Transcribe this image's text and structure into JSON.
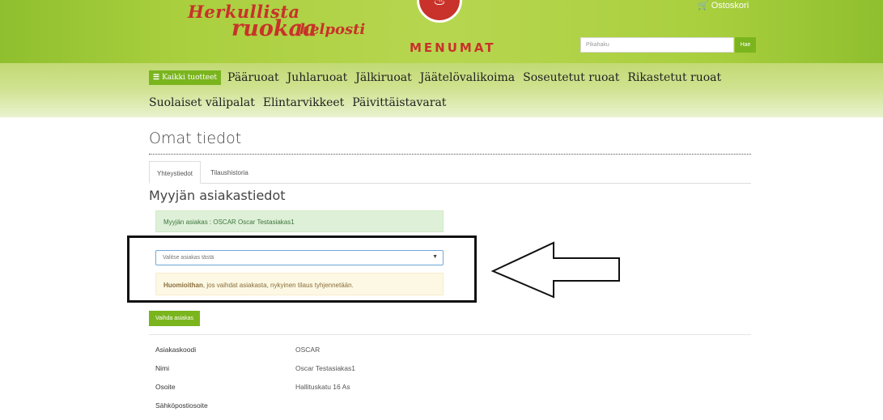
{
  "header": {
    "slogan_line1": "Herkullista",
    "slogan_line2": "ruokaa",
    "slogan_line3": "helposti",
    "brand": "MENUMAT",
    "cart_label": "Ostoskori",
    "search_placeholder": "Pikahaku",
    "search_button": "Hae"
  },
  "nav": {
    "all_products": "Kaikki tuotteet",
    "row1": [
      "Pääruoat",
      "Juhlaruoat",
      "Jälkiruoat",
      "Jäätelövalikoima",
      "Soseutetut ruoat",
      "Rikastetut ruoat"
    ],
    "row2": [
      "Suolaiset välipalat",
      "Elintarvikkeet",
      "Päivittäistavarat"
    ]
  },
  "page": {
    "title": "Omat tiedot",
    "tabs": [
      "Yhteystiedot",
      "Tilaushistoria"
    ],
    "section_title": "Myyjän asiakastiedot",
    "current_customer": "Myyjän asiakas : OSCAR Oscar Testasiakas1",
    "select_placeholder": "Valitse asiakas tästä",
    "warning_bold": "Huomioithan",
    "warning_rest": ", jos vaihdat asiakasta, nykyinen tilaus tyhjennetään.",
    "change_button": "Vaihda asiakas"
  },
  "customer_info": [
    {
      "label": "Asiakaskoodi",
      "value": "OSCAR"
    },
    {
      "label": "Nimi",
      "value": "Oscar Testasiakas1"
    },
    {
      "label": "Osoite",
      "value": "Hallituskatu 16 As"
    },
    {
      "label": "Sähköpostiosoite",
      "value": ""
    }
  ],
  "colors": {
    "accent_green": "#7ab51d",
    "brand_red": "#c8322a",
    "success_bg": "#dff0d8",
    "warning_bg": "#fcf8e3"
  }
}
